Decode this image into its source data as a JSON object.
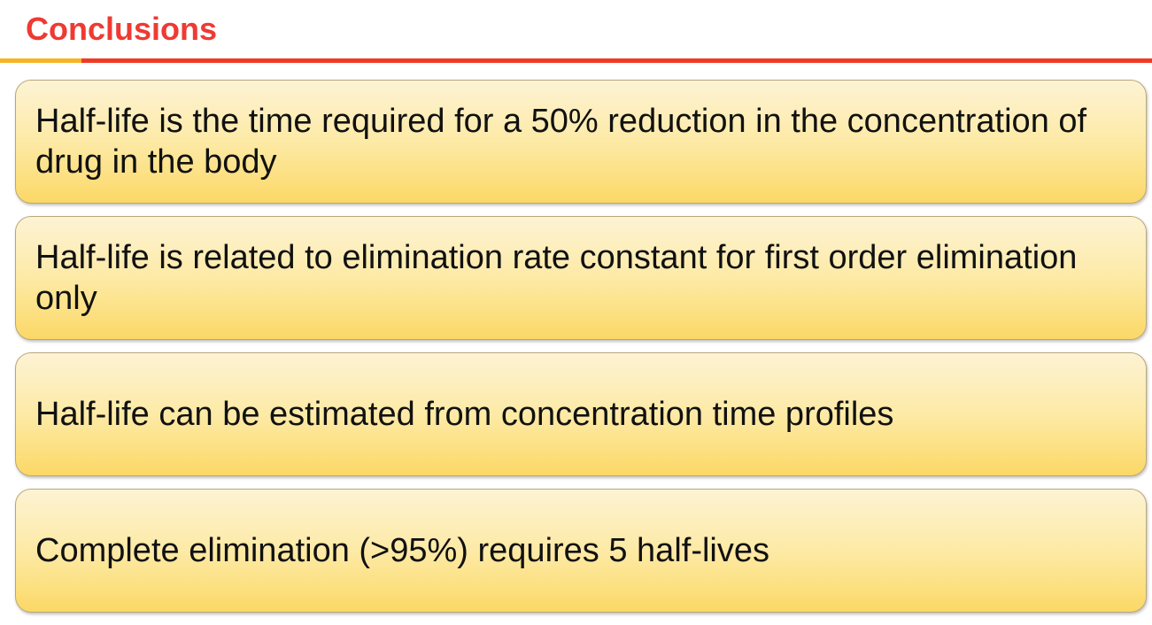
{
  "slide": {
    "title": "Conclusions",
    "accent_colors": {
      "title": "#ee3a33",
      "rule_left": "#f6b325",
      "rule_right": "#ef3a25"
    },
    "points": [
      "Half-life is the time required for a 50% reduction in the concentration of drug in the body",
      "Half-life is related to elimination rate constant for first order elimination only",
      "Half-life can be estimated from concentration time profiles",
      "Complete elimination (>95%) requires 5 half-lives"
    ]
  }
}
